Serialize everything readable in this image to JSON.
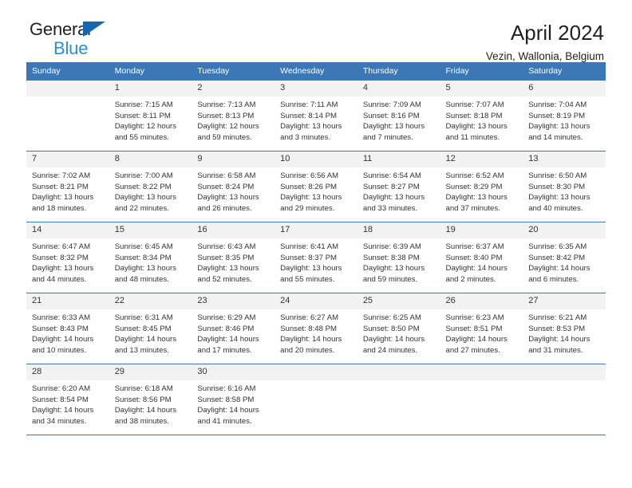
{
  "brand": {
    "name_top": "General",
    "name_bottom": "Blue",
    "flag_color": "#1267b2",
    "bottom_color": "#2a8fd4"
  },
  "header": {
    "title": "April 2024",
    "subtitle": "Vezin, Wallonia, Belgium"
  },
  "theme": {
    "header_bg": "#3b78b5",
    "daynum_bg": "#f2f2f2",
    "text": "#333333"
  },
  "weekdays": [
    "Sunday",
    "Monday",
    "Tuesday",
    "Wednesday",
    "Thursday",
    "Friday",
    "Saturday"
  ],
  "weeks": [
    [
      {
        "day": "",
        "info": ""
      },
      {
        "day": "1",
        "info": "Sunrise: 7:15 AM\nSunset: 8:11 PM\nDaylight: 12 hours\nand 55 minutes."
      },
      {
        "day": "2",
        "info": "Sunrise: 7:13 AM\nSunset: 8:13 PM\nDaylight: 12 hours\nand 59 minutes."
      },
      {
        "day": "3",
        "info": "Sunrise: 7:11 AM\nSunset: 8:14 PM\nDaylight: 13 hours\nand 3 minutes."
      },
      {
        "day": "4",
        "info": "Sunrise: 7:09 AM\nSunset: 8:16 PM\nDaylight: 13 hours\nand 7 minutes."
      },
      {
        "day": "5",
        "info": "Sunrise: 7:07 AM\nSunset: 8:18 PM\nDaylight: 13 hours\nand 11 minutes."
      },
      {
        "day": "6",
        "info": "Sunrise: 7:04 AM\nSunset: 8:19 PM\nDaylight: 13 hours\nand 14 minutes."
      }
    ],
    [
      {
        "day": "7",
        "info": "Sunrise: 7:02 AM\nSunset: 8:21 PM\nDaylight: 13 hours\nand 18 minutes."
      },
      {
        "day": "8",
        "info": "Sunrise: 7:00 AM\nSunset: 8:22 PM\nDaylight: 13 hours\nand 22 minutes."
      },
      {
        "day": "9",
        "info": "Sunrise: 6:58 AM\nSunset: 8:24 PM\nDaylight: 13 hours\nand 26 minutes."
      },
      {
        "day": "10",
        "info": "Sunrise: 6:56 AM\nSunset: 8:26 PM\nDaylight: 13 hours\nand 29 minutes."
      },
      {
        "day": "11",
        "info": "Sunrise: 6:54 AM\nSunset: 8:27 PM\nDaylight: 13 hours\nand 33 minutes."
      },
      {
        "day": "12",
        "info": "Sunrise: 6:52 AM\nSunset: 8:29 PM\nDaylight: 13 hours\nand 37 minutes."
      },
      {
        "day": "13",
        "info": "Sunrise: 6:50 AM\nSunset: 8:30 PM\nDaylight: 13 hours\nand 40 minutes."
      }
    ],
    [
      {
        "day": "14",
        "info": "Sunrise: 6:47 AM\nSunset: 8:32 PM\nDaylight: 13 hours\nand 44 minutes."
      },
      {
        "day": "15",
        "info": "Sunrise: 6:45 AM\nSunset: 8:34 PM\nDaylight: 13 hours\nand 48 minutes."
      },
      {
        "day": "16",
        "info": "Sunrise: 6:43 AM\nSunset: 8:35 PM\nDaylight: 13 hours\nand 52 minutes."
      },
      {
        "day": "17",
        "info": "Sunrise: 6:41 AM\nSunset: 8:37 PM\nDaylight: 13 hours\nand 55 minutes."
      },
      {
        "day": "18",
        "info": "Sunrise: 6:39 AM\nSunset: 8:38 PM\nDaylight: 13 hours\nand 59 minutes."
      },
      {
        "day": "19",
        "info": "Sunrise: 6:37 AM\nSunset: 8:40 PM\nDaylight: 14 hours\nand 2 minutes."
      },
      {
        "day": "20",
        "info": "Sunrise: 6:35 AM\nSunset: 8:42 PM\nDaylight: 14 hours\nand 6 minutes."
      }
    ],
    [
      {
        "day": "21",
        "info": "Sunrise: 6:33 AM\nSunset: 8:43 PM\nDaylight: 14 hours\nand 10 minutes."
      },
      {
        "day": "22",
        "info": "Sunrise: 6:31 AM\nSunset: 8:45 PM\nDaylight: 14 hours\nand 13 minutes."
      },
      {
        "day": "23",
        "info": "Sunrise: 6:29 AM\nSunset: 8:46 PM\nDaylight: 14 hours\nand 17 minutes."
      },
      {
        "day": "24",
        "info": "Sunrise: 6:27 AM\nSunset: 8:48 PM\nDaylight: 14 hours\nand 20 minutes."
      },
      {
        "day": "25",
        "info": "Sunrise: 6:25 AM\nSunset: 8:50 PM\nDaylight: 14 hours\nand 24 minutes."
      },
      {
        "day": "26",
        "info": "Sunrise: 6:23 AM\nSunset: 8:51 PM\nDaylight: 14 hours\nand 27 minutes."
      },
      {
        "day": "27",
        "info": "Sunrise: 6:21 AM\nSunset: 8:53 PM\nDaylight: 14 hours\nand 31 minutes."
      }
    ],
    [
      {
        "day": "28",
        "info": "Sunrise: 6:20 AM\nSunset: 8:54 PM\nDaylight: 14 hours\nand 34 minutes."
      },
      {
        "day": "29",
        "info": "Sunrise: 6:18 AM\nSunset: 8:56 PM\nDaylight: 14 hours\nand 38 minutes."
      },
      {
        "day": "30",
        "info": "Sunrise: 6:16 AM\nSunset: 8:58 PM\nDaylight: 14 hours\nand 41 minutes."
      },
      {
        "day": "",
        "info": ""
      },
      {
        "day": "",
        "info": ""
      },
      {
        "day": "",
        "info": ""
      },
      {
        "day": "",
        "info": ""
      }
    ]
  ]
}
